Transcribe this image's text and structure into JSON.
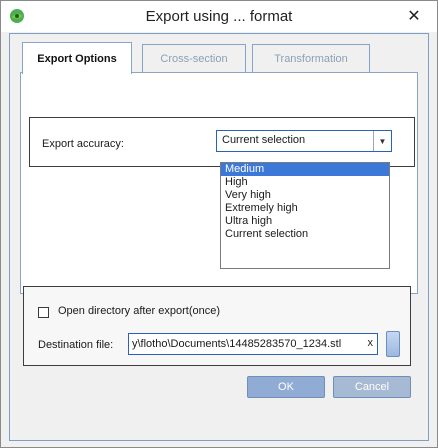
{
  "window": {
    "title": "Export using ... format",
    "close_glyph": "✕"
  },
  "tabs": [
    {
      "label": "Export Options",
      "active": true
    },
    {
      "label": "Cross-section",
      "active": false
    },
    {
      "label": "Transformation",
      "active": false
    }
  ],
  "accuracy": {
    "label": "Export accuracy:",
    "selected": "Current selection",
    "options": [
      "Medium",
      "High",
      "Very high",
      "Extremely high",
      "Ultra high",
      "Current selection"
    ],
    "highlighted_option": "Medium"
  },
  "export": {
    "open_dir_label": "Open directory after export(once)",
    "open_dir_checked": false,
    "destination_label": "Destination file:",
    "destination_value": "y\\flotho\\Documents\\14485283570_1234.stl",
    "clear_glyph": "x"
  },
  "buttons": {
    "ok": "OK",
    "cancel": "Cancel"
  },
  "colors": {
    "accent": "#3b78d8",
    "button": "#9fb7d9"
  }
}
